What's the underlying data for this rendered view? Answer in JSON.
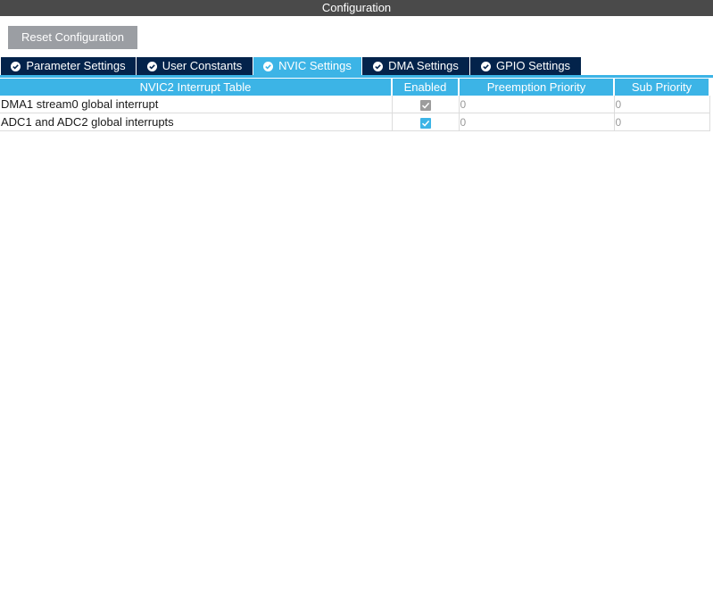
{
  "window": {
    "title": "Configuration"
  },
  "toolbar": {
    "reset_label": "Reset Configuration"
  },
  "tabs": [
    {
      "label": "Parameter Settings",
      "active": false
    },
    {
      "label": "User Constants",
      "active": false
    },
    {
      "label": "NVIC Settings",
      "active": true
    },
    {
      "label": "DMA Settings",
      "active": false
    },
    {
      "label": "GPIO Settings",
      "active": false
    }
  ],
  "table": {
    "headers": [
      "NVIC2 Interrupt Table",
      "Enabled",
      "Preemption Priority",
      "Sub Priority"
    ],
    "rows": [
      {
        "name": "DMA1 stream0 global interrupt",
        "enabled": true,
        "enabled_editable": false,
        "preemption": "0",
        "sub": "0"
      },
      {
        "name": "ADC1 and ADC2 global interrupts",
        "enabled": true,
        "enabled_editable": true,
        "preemption": "0",
        "sub": "0"
      }
    ]
  },
  "colors": {
    "title_bar": "#4a4a4a",
    "tab_inactive": "#03234b",
    "tab_active": "#3cb4e6",
    "header": "#3cb4e6",
    "button": "#9b9ea3"
  },
  "icons": {
    "tab_icon": "check-circle-icon",
    "checkbox": "checkmark-icon"
  }
}
